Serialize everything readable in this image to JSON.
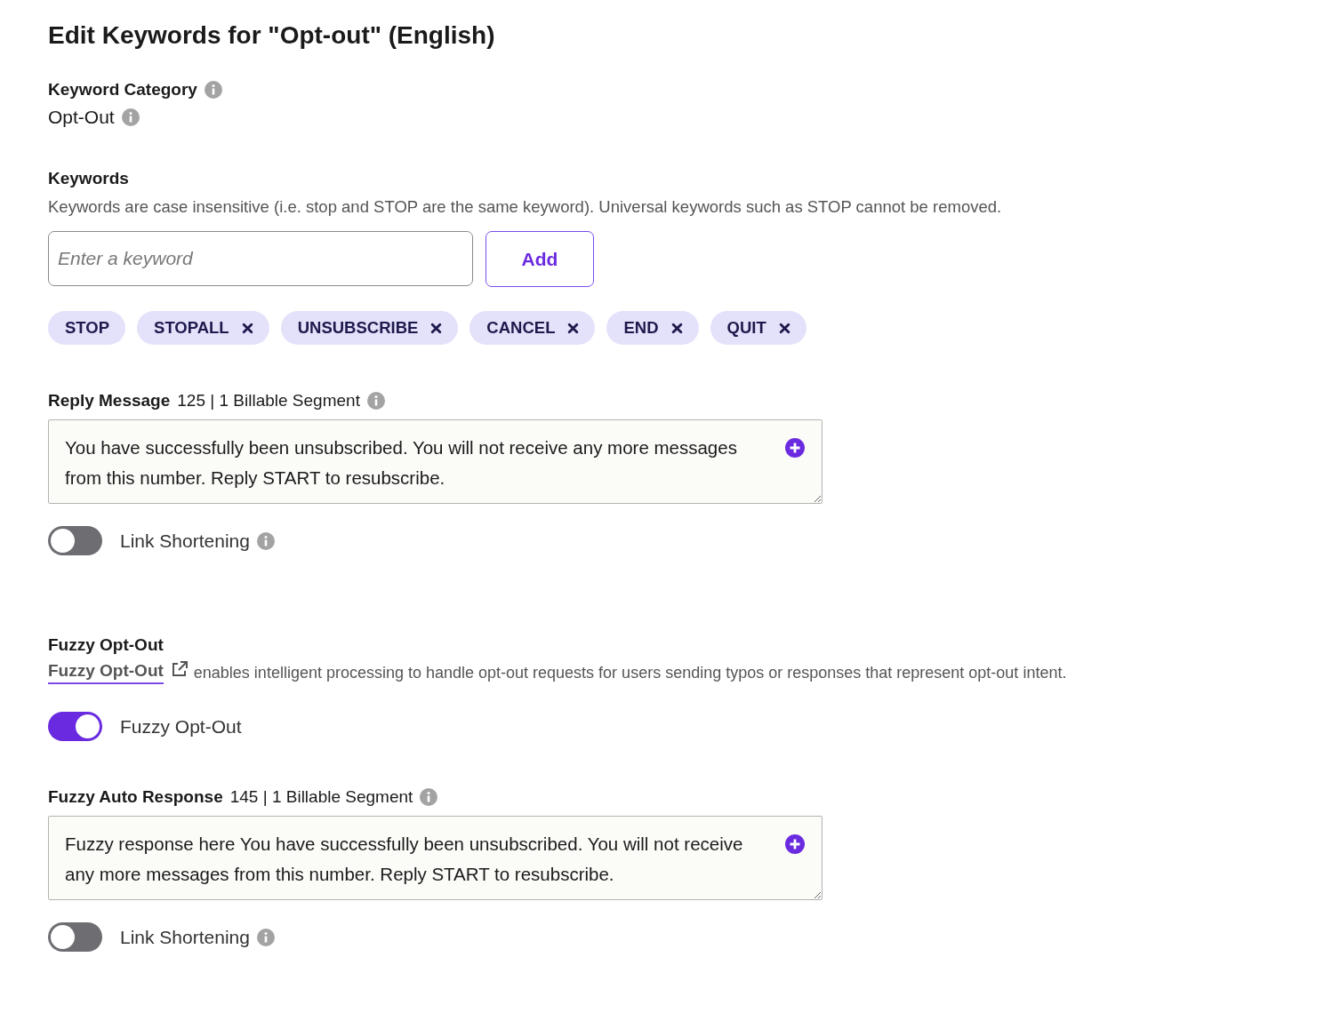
{
  "title": "Edit Keywords for \"Opt-out\" (English)",
  "keyword_category": {
    "label": "Keyword Category",
    "value": "Opt-Out"
  },
  "keywords": {
    "label": "Keywords",
    "description": "Keywords are case insensitive (i.e. stop and STOP are the same keyword). Universal keywords such as STOP cannot be removed.",
    "input": {
      "placeholder": "Enter a keyword"
    },
    "add_button": "Add",
    "chips": [
      {
        "label": "STOP",
        "removable": false
      },
      {
        "label": "STOPALL",
        "removable": true
      },
      {
        "label": "UNSUBSCRIBE",
        "removable": true
      },
      {
        "label": "CANCEL",
        "removable": true
      },
      {
        "label": "END",
        "removable": true
      },
      {
        "label": "QUIT",
        "removable": true
      }
    ]
  },
  "reply_message": {
    "label": "Reply Message",
    "count": "125 | 1 Billable Segment",
    "value": "You have successfully been unsubscribed. You will not receive any more messages from this number. Reply START to resubscribe.",
    "link_shortening": {
      "label": "Link Shortening",
      "on": false
    }
  },
  "fuzzy_opt_out": {
    "heading": "Fuzzy Opt-Out",
    "link": "Fuzzy Opt-Out",
    "description": "enables intelligent processing to handle opt-out requests for users sending typos or responses that represent opt-out intent.",
    "toggle": {
      "label": "Fuzzy Opt-Out",
      "on": true
    }
  },
  "fuzzy_auto_response": {
    "label": "Fuzzy Auto Response",
    "count": "145 | 1 Billable Segment",
    "value": "Fuzzy response here You have successfully been unsubscribed. You will not receive any more messages from this number. Reply START to resubscribe.",
    "link_shortening": {
      "label": "Link Shortening",
      "on": false
    }
  }
}
